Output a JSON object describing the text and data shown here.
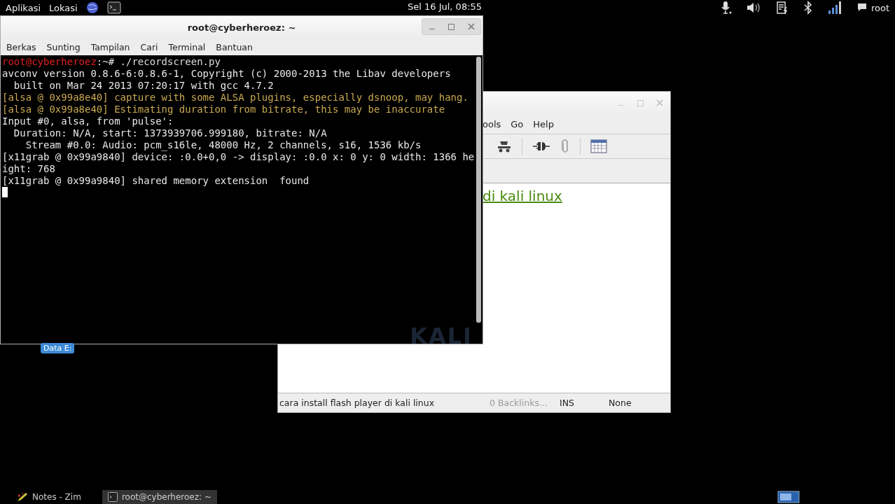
{
  "top_bar": {
    "menus": [
      "Aplikasi",
      "Lokasi"
    ],
    "clock": "Sel 16 Jul, 08:55",
    "user": "root"
  },
  "terminal_window": {
    "title": "root@cyberheroez: ~",
    "menu": [
      "Berkas",
      "Sunting",
      "Tampilan",
      "Cari",
      "Terminal",
      "Bantuan"
    ],
    "prompt": {
      "user": "root@cyberheroez",
      "rest": ":~# ./recordscreen.py"
    },
    "lines": [
      {
        "text": "avconv version 0.8.6-6:0.8.6-1, Copyright (c) 2000-2013 the Libav developers",
        "kind": "normal"
      },
      {
        "text": "  built on Mar 24 2013 07:20:17 with gcc 4.7.2",
        "kind": "normal"
      },
      {
        "text": "[alsa @ 0x99a8e40] capture with some ALSA plugins, especially dsnoop, may hang.",
        "kind": "warning"
      },
      {
        "text": "[alsa @ 0x99a8e40] Estimating duration from bitrate, this may be inaccurate",
        "kind": "warning"
      },
      {
        "text": "Input #0, alsa, from 'pulse':",
        "kind": "normal"
      },
      {
        "text": "  Duration: N/A, start: 1373939706.999180, bitrate: N/A",
        "kind": "normal"
      },
      {
        "text": "    Stream #0.0: Audio: pcm_s16le, 48000 Hz, 2 channels, s16, 1536 kb/s",
        "kind": "normal"
      },
      {
        "text": "[x11grab @ 0x99a9840] device: :0.0+0,0 -> display: :0.0 x: 0 y: 0 width: 1366 he",
        "kind": "normal"
      },
      {
        "text": "ight: 768",
        "kind": "normal"
      },
      {
        "text": "[x11grab @ 0x99a9840] shared memory extension  found",
        "kind": "normal"
      }
    ],
    "wallpaper_logo": "KALI"
  },
  "zim_window": {
    "menu": [
      "ools",
      "Go",
      "Help"
    ],
    "toolbar": [
      {
        "kind": "cart",
        "disabled": false
      },
      {
        "kind": "plug",
        "disabled": false
      },
      {
        "kind": "clip",
        "disabled": true
      },
      {
        "kind": "calendar",
        "disabled": false
      }
    ],
    "heading_link": "di kali linux",
    "status_bar": {
      "page": "cara install flash player di kali linux",
      "backlinks": "0 Backlinks...",
      "mode": "INS",
      "style": "None"
    }
  },
  "desktop_icon": {
    "label": "Data E:"
  },
  "taskbar": [
    {
      "label": "Notes - Zim",
      "kind": "zim",
      "selected": false
    },
    {
      "label": "root@cyberheroez: ~",
      "kind": "terminal",
      "selected": true
    }
  ]
}
